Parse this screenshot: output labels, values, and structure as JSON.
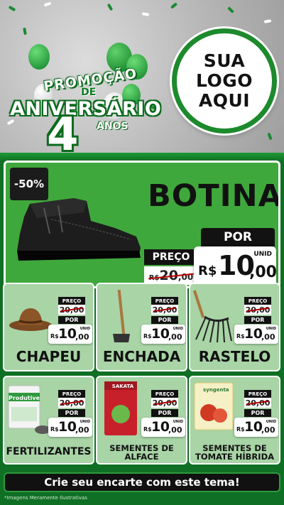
{
  "header": {
    "promo_line": "PROMOÇÃO",
    "de": "DE",
    "aniversario": "ANIVERSÁRIO",
    "number": "4",
    "anos": "ANOS",
    "logo_lines": [
      "SUA",
      "LOGO",
      "AQUI"
    ]
  },
  "colors": {
    "brand_green": "#0f6f24",
    "accent_green": "#3fa83c",
    "card_bg": "#a8d4a6",
    "dark": "#111111"
  },
  "featured": {
    "discount": "-50%",
    "title": "BOTINA",
    "preco_label": "PREÇO",
    "old_price_int": "20",
    "old_price_cents": ",00",
    "old_prefix": "R$",
    "por_label": "POR",
    "new_prefix": "R$",
    "new_price_int": "10",
    "new_price_cents": ",00",
    "unit": "UNID"
  },
  "products": [
    {
      "title": "CHAPEU",
      "icon": "hat-icon",
      "preco_label": "PREÇO",
      "old_price": "20,00",
      "por_label": "POR",
      "new_prefix": "R$",
      "new_price_int": "10",
      "new_price_cents": ",00",
      "unit": "UNID"
    },
    {
      "title": "ENCHADA",
      "icon": "hoe-icon",
      "preco_label": "PREÇO",
      "old_price": "20,00",
      "por_label": "POR",
      "new_prefix": "R$",
      "new_price_int": "10",
      "new_price_cents": ",00",
      "unit": "UNID"
    },
    {
      "title": "RASTELO",
      "icon": "rake-icon",
      "preco_label": "PREÇO",
      "old_price": "20,00",
      "por_label": "POR",
      "new_prefix": "R$",
      "new_price_int": "10",
      "new_price_cents": ",00",
      "unit": "UNID"
    },
    {
      "title": "FERTILIZANTES",
      "icon": "fertilizer-bag-icon",
      "pack_label": "Produtive",
      "preco_label": "PREÇO",
      "old_price": "20,00",
      "por_label": "POR",
      "new_prefix": "R$",
      "new_price_int": "10",
      "new_price_cents": ",00",
      "unit": "UNID"
    },
    {
      "title": "SEMENTES DE\nALFACE",
      "title_line1": "SEMENTES DE",
      "title_line2": "ALFACE",
      "icon": "seed-packet-icon",
      "pack_label": "SAKATA",
      "preco_label": "PREÇO",
      "old_price": "20,00",
      "por_label": "POR",
      "new_prefix": "R$",
      "new_price_int": "10",
      "new_price_cents": ",00",
      "unit": "UNID"
    },
    {
      "title": "SEMENTES DE\nTOMATE HÍBRIDA",
      "title_line1": "SEMENTES DE",
      "title_line2": "TOMATE HÍBRIDA",
      "icon": "seed-packet-icon",
      "pack_label": "syngenta",
      "preco_label": "PREÇO",
      "old_price": "20,00",
      "por_label": "POR",
      "new_prefix": "R$",
      "new_price_int": "10",
      "new_price_cents": ",00",
      "unit": "UNID"
    }
  ],
  "cta": "Crie seu encarte com este tema!",
  "disclaimer": "*Imagens Meramente Ilustrativas"
}
